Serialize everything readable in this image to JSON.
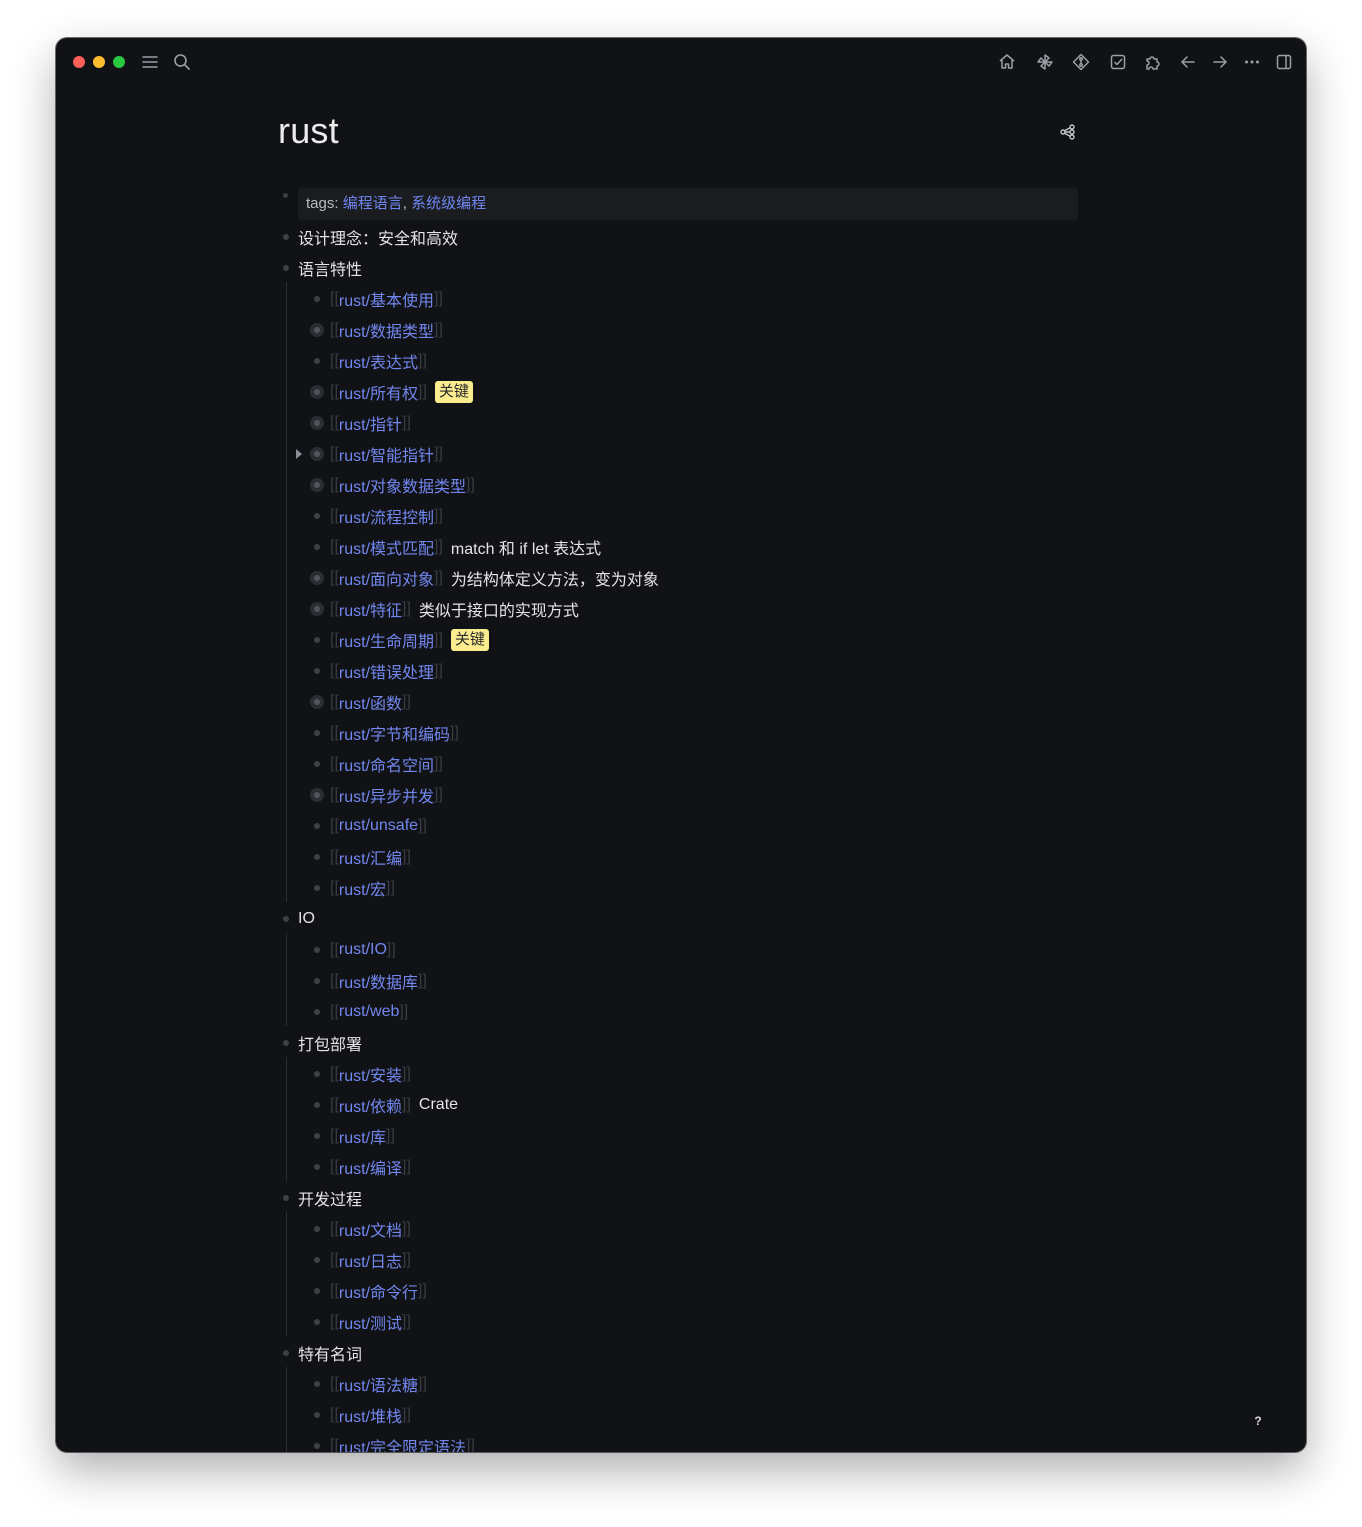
{
  "page": {
    "title": "rust",
    "properties": {
      "key": "tags",
      "separator": ": ",
      "comma": ", ",
      "values": [
        "编程语言",
        "系统级编程"
      ]
    }
  },
  "outline": [
    {
      "text": "设计理念：安全和高效",
      "children": []
    },
    {
      "text": "语言特性",
      "children": [
        {
          "link": "rust/基本使用"
        },
        {
          "link": "rust/数据类型",
          "collapsed": true
        },
        {
          "link": "rust/表达式"
        },
        {
          "link": "rust/所有权",
          "collapsed": true,
          "highlight": "关键"
        },
        {
          "link": "rust/指针",
          "collapsed": true
        },
        {
          "link": "rust/智能指针",
          "collapsed": true,
          "arrow": true
        },
        {
          "link": "rust/对象数据类型",
          "collapsed": true
        },
        {
          "link": "rust/流程控制"
        },
        {
          "link": "rust/模式匹配",
          "note": "match 和 if let 表达式"
        },
        {
          "link": "rust/面向对象",
          "collapsed": true,
          "note": "为结构体定义方法，变为对象"
        },
        {
          "link": "rust/特征",
          "collapsed": true,
          "note": "类似于接口的实现方式"
        },
        {
          "link": "rust/生命周期",
          "highlight": "关键"
        },
        {
          "link": "rust/错误处理"
        },
        {
          "link": "rust/函数",
          "collapsed": true
        },
        {
          "link": "rust/字节和编码"
        },
        {
          "link": "rust/命名空间"
        },
        {
          "link": "rust/异步并发",
          "collapsed": true
        },
        {
          "link": "rust/unsafe"
        },
        {
          "link": "rust/汇编"
        },
        {
          "link": "rust/宏"
        }
      ]
    },
    {
      "text": "IO",
      "children": [
        {
          "link": "rust/IO"
        },
        {
          "link": "rust/数据库"
        },
        {
          "link": "rust/web"
        }
      ]
    },
    {
      "text": "打包部署",
      "children": [
        {
          "link": "rust/安装"
        },
        {
          "link": "rust/依赖",
          "note": "Crate"
        },
        {
          "link": "rust/库"
        },
        {
          "link": "rust/编译"
        }
      ]
    },
    {
      "text": "开发过程",
      "children": [
        {
          "link": "rust/文档"
        },
        {
          "link": "rust/日志"
        },
        {
          "link": "rust/命令行"
        },
        {
          "link": "rust/测试"
        }
      ]
    },
    {
      "text": "特有名词",
      "children": [
        {
          "link": "rust/语法糖"
        },
        {
          "link": "rust/堆栈"
        },
        {
          "link": "rust/完全限定语法"
        }
      ]
    }
  ],
  "link_brackets": {
    "open": "[[",
    "close": "]]"
  },
  "toolbar": {
    "left": [
      "menu-icon",
      "search-icon"
    ],
    "right": [
      "home-icon",
      "plugin-pinwheel-icon",
      "git-icon",
      "todo-icon",
      "extensions-icon",
      "back-icon",
      "forward-icon",
      "more-icon",
      "sidebar-toggle-icon"
    ]
  },
  "help": {
    "label": "?"
  },
  "colors": {
    "background": "#111215",
    "link": "#7187ee",
    "text": "#e4e4e6",
    "highlight": "#fbec8f",
    "bullet": "#3d4047"
  }
}
